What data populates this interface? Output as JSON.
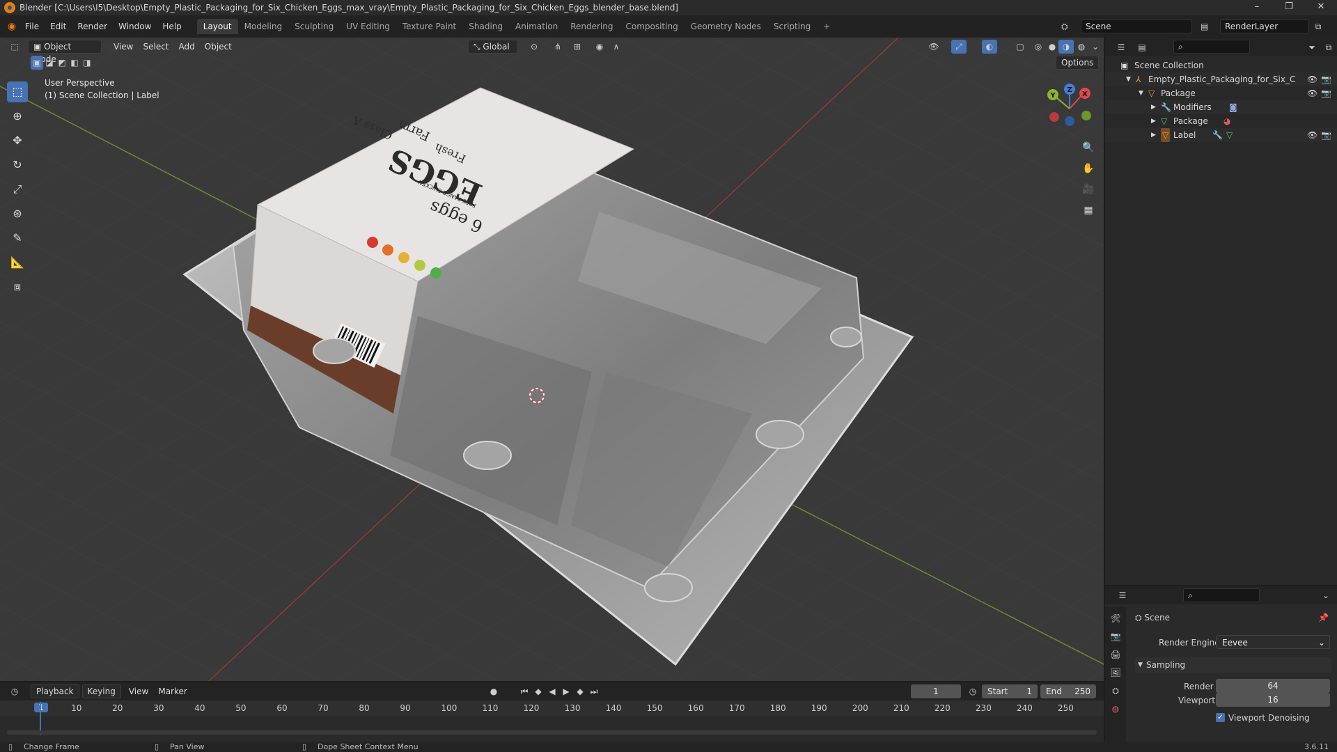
{
  "window": {
    "title": "Blender [C:\\Users\\I5\\Desktop\\Empty_Plastic_Packaging_for_Six_Chicken_Eggs_max_vray\\Empty_Plastic_Packaging_for_Six_Chicken_Eggs_blender_base.blend]",
    "minimize": "–",
    "maximize": "❐",
    "close": "✕"
  },
  "menu": [
    "File",
    "Edit",
    "Render",
    "Window",
    "Help"
  ],
  "workspaces": [
    "Layout",
    "Modeling",
    "Sculpting",
    "UV Editing",
    "Texture Paint",
    "Shading",
    "Animation",
    "Rendering",
    "Compositing",
    "Geometry Nodes",
    "Scripting"
  ],
  "active_workspace": "Layout",
  "add_workspace": "+",
  "scene_field": "Scene",
  "renderlayer_field": "RenderLayer",
  "viewport": {
    "mode": "Object Mode",
    "menus": [
      "View",
      "Select",
      "Add",
      "Object"
    ],
    "transform": "Global",
    "options": "Options",
    "overlay_line1": "User Perspective",
    "overlay_line2": "(1) Scene Collection | Label",
    "gizmo": {
      "x": "X",
      "y": "Y",
      "z": "Z"
    },
    "label_texts": {
      "eggs": "EGGS",
      "count": "6 eggs",
      "fresh": "Fresh",
      "farm": "Farm",
      "class": "Class A",
      "freerange": "FREE RANGE CHICKEN"
    }
  },
  "outliner": {
    "root": "Scene Collection",
    "items": [
      {
        "name": "Empty_Plastic_Packaging_for_Six_Chick",
        "depth": 1
      },
      {
        "name": "Package",
        "depth": 2
      },
      {
        "name": "Modifiers",
        "depth": 3
      },
      {
        "name": "Package",
        "depth": 3
      },
      {
        "name": "Label",
        "depth": 3
      }
    ]
  },
  "properties": {
    "context": "Scene",
    "render_engine_label": "Render Engine",
    "render_engine": "Eevee",
    "sampling_label": "Sampling",
    "render_label": "Render",
    "render_value": "64",
    "viewport_label": "Viewport",
    "viewport_value": "16",
    "denoise_label": "Viewport Denoising",
    "denoise_checked": true
  },
  "timeline": {
    "menus": [
      "Playback",
      "Keying",
      "View",
      "Marker"
    ],
    "current_frame": "1",
    "start_label": "Start",
    "start": "1",
    "end_label": "End",
    "end": "250",
    "ticks": [
      "1",
      "10",
      "20",
      "30",
      "40",
      "50",
      "60",
      "70",
      "80",
      "90",
      "100",
      "110",
      "120",
      "130",
      "140",
      "150",
      "160",
      "170",
      "180",
      "190",
      "200",
      "210",
      "220",
      "230",
      "240",
      "250"
    ]
  },
  "status": {
    "left": "Change Frame",
    "middle": "Pan View",
    "right": "Dope Sheet Context Menu",
    "version": "3.6.11"
  },
  "colors": {
    "accent": "#4772b3",
    "x_axis": "#e5454d",
    "y_axis": "#8ab82d",
    "z_axis": "#3f7fd4"
  }
}
